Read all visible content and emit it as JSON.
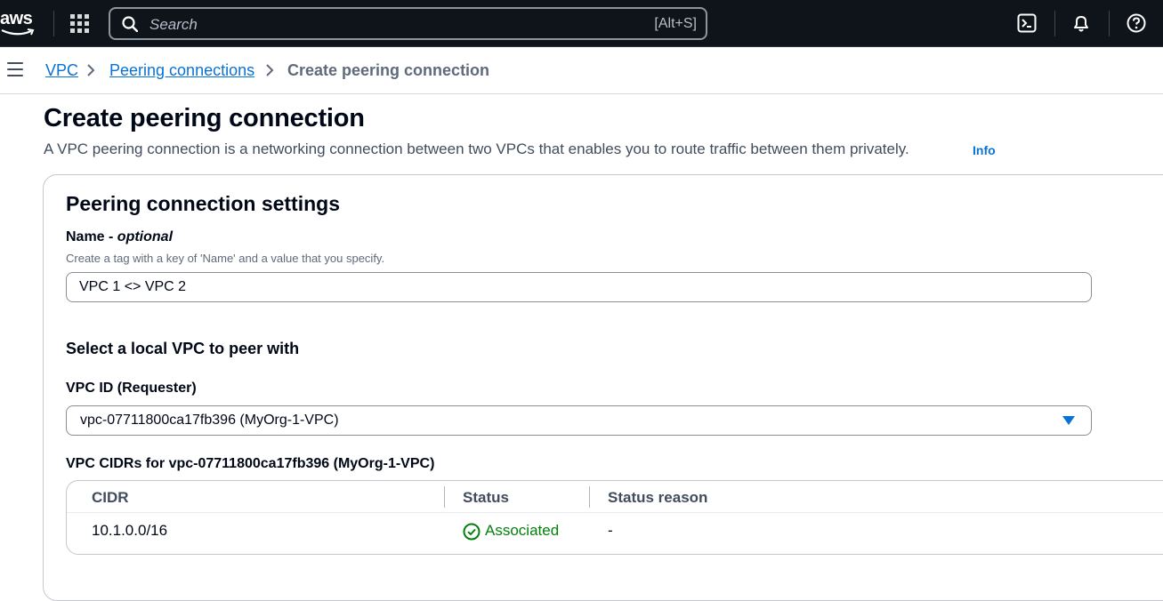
{
  "topnav": {
    "logo_text": "aws",
    "search_placeholder": "Search",
    "search_shortcut": "[Alt+S]",
    "icons": [
      "services-grid-icon",
      "search-icon",
      "cloudshell-icon",
      "bell-icon",
      "help-icon"
    ]
  },
  "breadcrumb": {
    "items": [
      {
        "label": "VPC"
      },
      {
        "label": "Peering connections"
      },
      {
        "label": "Create peering connection"
      }
    ]
  },
  "header": {
    "title": "Create peering connection",
    "description": "A VPC peering connection is a networking connection between two VPCs that enables you to route traffic between them privately.",
    "info_label": "Info"
  },
  "settings": {
    "title": "Peering connection settings",
    "name_label": "Name",
    "name_optional": "optional",
    "name_separator": " - ",
    "name_description": "Create a tag with a key of 'Name' and a value that you specify.",
    "name_value": "VPC 1 <> VPC 2",
    "local_vpc_title": "Select a local VPC to peer with",
    "vpc_id_label": "VPC ID (Requester)",
    "vpc_id_value": "vpc-07711800ca17fb396 (MyOrg-1-VPC)",
    "cidrs_title": "VPC CIDRs for vpc-07711800ca17fb396 (MyOrg-1-VPC)"
  },
  "cidr_table": {
    "columns": [
      "CIDR",
      "Status",
      "Status reason"
    ],
    "rows": [
      {
        "cidr": "10.1.0.0/16",
        "status": "Associated",
        "status_reason": "-"
      }
    ]
  },
  "colors": {
    "nav_bg": "#0f141a",
    "link": "#0972d3",
    "success": "#037f0c"
  }
}
